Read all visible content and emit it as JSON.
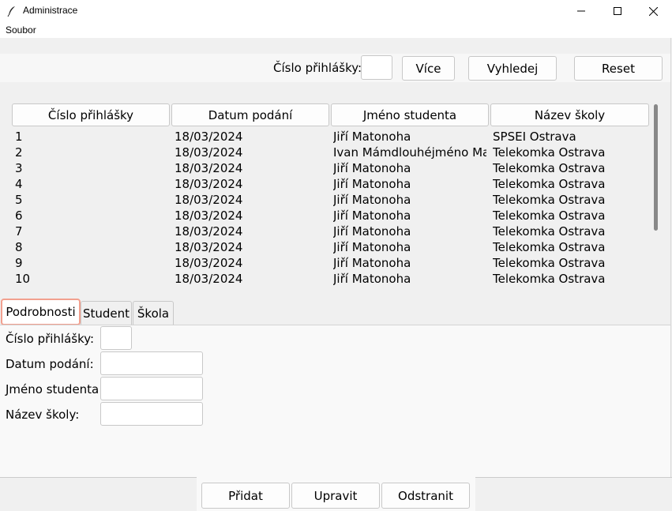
{
  "window": {
    "title": "Administrace",
    "icon": "feather-icon"
  },
  "menu": {
    "items": [
      "Soubor"
    ]
  },
  "search": {
    "label": "Číslo přihlášky:",
    "input_value": "",
    "buttons": {
      "more": "Více",
      "find": "Vyhledej",
      "reset": "Reset"
    }
  },
  "table": {
    "columns": [
      "Číslo přihlášky",
      "Datum podání",
      "Jméno studenta",
      "Název školy"
    ],
    "rows": [
      [
        "1",
        "18/03/2024",
        "Jiří Matonoha",
        "SPSEI Ostrava"
      ],
      [
        "2",
        "18/03/2024",
        "Ivan Mámdlouhéjméno Matonoha",
        "Telekomka Ostrava"
      ],
      [
        "3",
        "18/03/2024",
        "Jiří Matonoha",
        "Telekomka Ostrava"
      ],
      [
        "4",
        "18/03/2024",
        "Jiří Matonoha",
        "Telekomka Ostrava"
      ],
      [
        "5",
        "18/03/2024",
        "Jiří Matonoha",
        "Telekomka Ostrava"
      ],
      [
        "6",
        "18/03/2024",
        "Jiří Matonoha",
        "Telekomka Ostrava"
      ],
      [
        "7",
        "18/03/2024",
        "Jiří Matonoha",
        "Telekomka Ostrava"
      ],
      [
        "8",
        "18/03/2024",
        "Jiří Matonoha",
        "Telekomka Ostrava"
      ],
      [
        "9",
        "18/03/2024",
        "Jiří Matonoha",
        "Telekomka Ostrava"
      ],
      [
        "10",
        "18/03/2024",
        "Jiří Matonoha",
        "Telekomka Ostrava"
      ]
    ]
  },
  "tabs": {
    "items": [
      "Podrobnosti",
      "Student",
      "Škola"
    ],
    "active": "Podrobnosti"
  },
  "details": {
    "fields": [
      {
        "label": "Číslo přihlášky:",
        "value": ""
      },
      {
        "label": "Datum podání:",
        "value": ""
      },
      {
        "label": "Jméno studenta:",
        "value": ""
      },
      {
        "label": "Název školy:",
        "value": ""
      }
    ]
  },
  "actions": {
    "add": "Přidat",
    "edit": "Upravit",
    "remove": "Odstranit"
  },
  "colors": {
    "active_tab_border": "#f2a08f",
    "scrollbar_thumb": "#888888"
  }
}
